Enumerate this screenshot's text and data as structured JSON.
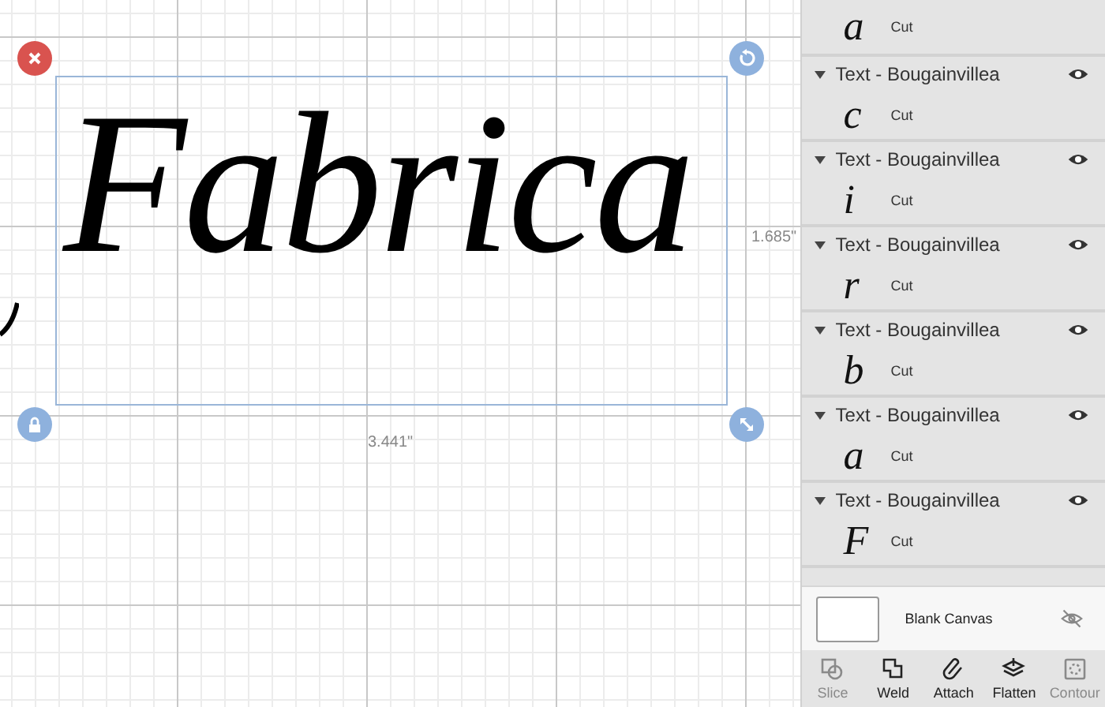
{
  "canvas": {
    "text": "Fabrica",
    "width_label": "3.441\"",
    "height_label": "1.685\""
  },
  "layers": [
    {
      "glyph": "a",
      "operation": "Cut"
    },
    {
      "title": "Text - Bougainvillea",
      "visible": true,
      "glyph": "c",
      "operation": "Cut"
    },
    {
      "title": "Text - Bougainvillea",
      "visible": true,
      "glyph": "i",
      "operation": "Cut"
    },
    {
      "title": "Text - Bougainvillea",
      "visible": true,
      "glyph": "r",
      "operation": "Cut"
    },
    {
      "title": "Text - Bougainvillea",
      "visible": true,
      "glyph": "b",
      "operation": "Cut"
    },
    {
      "title": "Text - Bougainvillea",
      "visible": true,
      "glyph": "a",
      "operation": "Cut"
    },
    {
      "title": "Text - Bougainvillea",
      "visible": true,
      "glyph": "F",
      "operation": "Cut"
    }
  ],
  "blank_canvas": {
    "label": "Blank Canvas",
    "visible": false
  },
  "toolbar": [
    {
      "kind": "slice",
      "label": "Slice",
      "disabled": true
    },
    {
      "kind": "weld",
      "label": "Weld",
      "disabled": false
    },
    {
      "kind": "attach",
      "label": "Attach",
      "disabled": false
    },
    {
      "kind": "flatten",
      "label": "Flatten",
      "disabled": false
    },
    {
      "kind": "contour",
      "label": "Contour",
      "disabled": true
    }
  ]
}
